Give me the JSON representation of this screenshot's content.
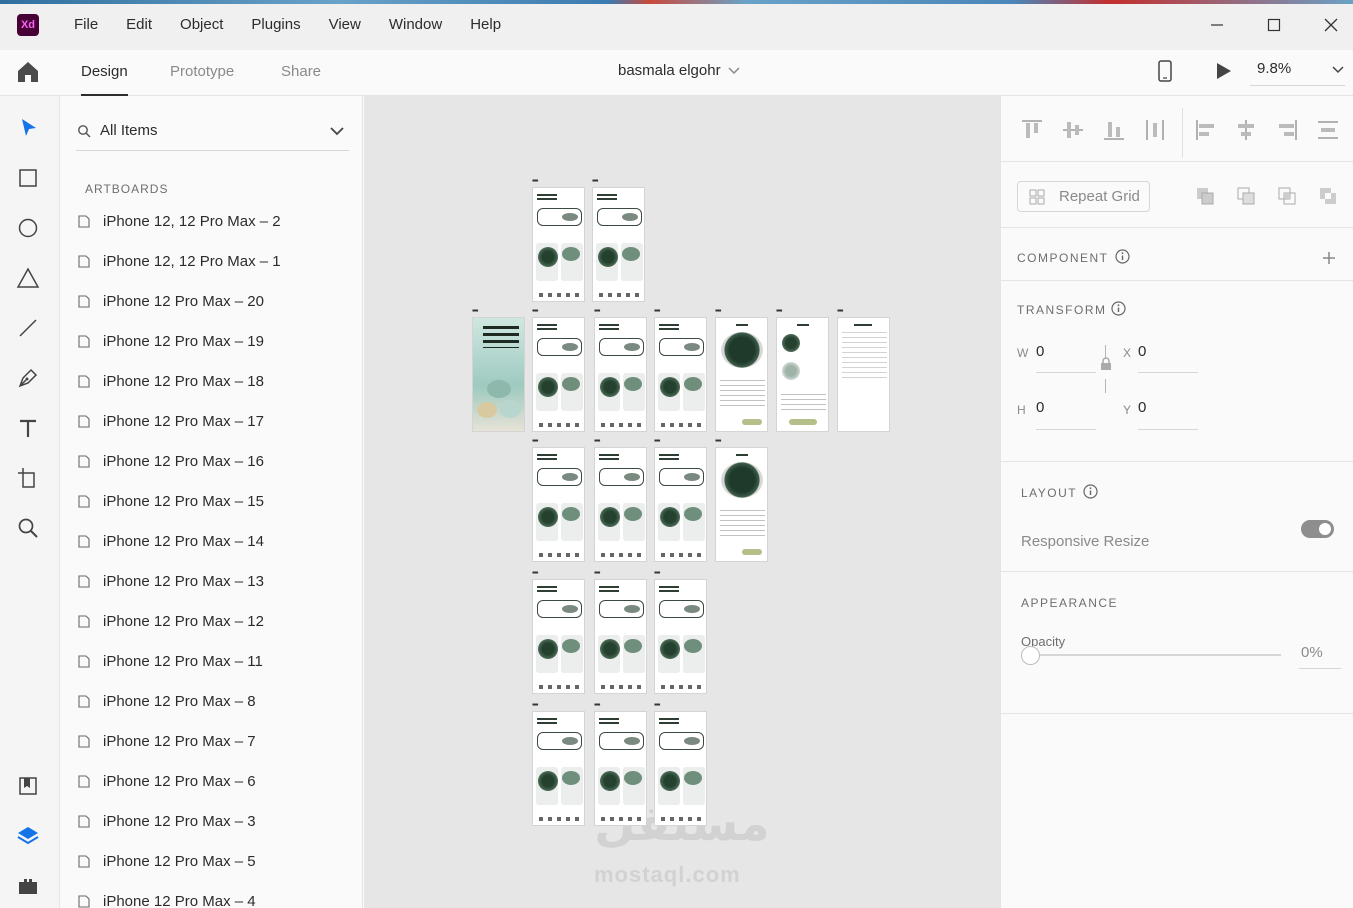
{
  "app": {
    "logo_text": "Xd",
    "menu": [
      "File",
      "Edit",
      "Object",
      "Plugins",
      "View",
      "Window",
      "Help"
    ]
  },
  "toolbar": {
    "tabs": [
      "Design",
      "Prototype",
      "Share"
    ],
    "active_tab": "Design",
    "document_title": "basmala elgohr",
    "zoom": "9.8%"
  },
  "tools": [
    "select-icon",
    "rectangle-icon",
    "ellipse-icon",
    "polygon-icon",
    "line-icon",
    "pen-icon",
    "text-icon",
    "artboard-icon",
    "zoom-icon",
    "assets-icon",
    "layers-icon",
    "plugins-icon"
  ],
  "layers": {
    "filter": "All Items",
    "section": "ARTBOARDS",
    "items": [
      "iPhone 12, 12 Pro Max – 2",
      "iPhone 12, 12 Pro Max – 1",
      "iPhone 12 Pro Max – 20",
      "iPhone 12 Pro Max – 19",
      "iPhone 12 Pro Max – 18",
      "iPhone 12 Pro Max – 17",
      "iPhone 12 Pro Max – 16",
      "iPhone 12 Pro Max – 15",
      "iPhone 12 Pro Max – 14",
      "iPhone 12 Pro Max – 13",
      "iPhone 12 Pro Max – 12",
      "iPhone 12 Pro Max – 11",
      "iPhone 12 Pro Max – 8",
      "iPhone 12 Pro Max – 7",
      "iPhone 12 Pro Max – 6",
      "iPhone 12 Pro Max – 3",
      "iPhone 12 Pro Max – 5",
      "iPhone 12 Pro Max – 4"
    ]
  },
  "canvas": {
    "watermark_arabic": "مستقل",
    "watermark_latin": "mostaql.com"
  },
  "inspector": {
    "repeat_grid": "Repeat Grid",
    "component": "COMPONENT",
    "transform": "TRANSFORM",
    "w_label": "W",
    "w_value": "0",
    "h_label": "H",
    "h_value": "0",
    "x_label": "X",
    "x_value": "0",
    "y_label": "Y",
    "y_value": "0",
    "layout": "LAYOUT",
    "responsive_resize": "Responsive Resize",
    "responsive_resize_on": true,
    "appearance": "APPEARANCE",
    "opacity_label": "Opacity",
    "opacity_value": "0%"
  },
  "colors": {
    "accent": "#1473e6",
    "xd_brand": "#470137",
    "canvas_bg": "#e6e6e6",
    "pottery_green": "#24402e"
  }
}
